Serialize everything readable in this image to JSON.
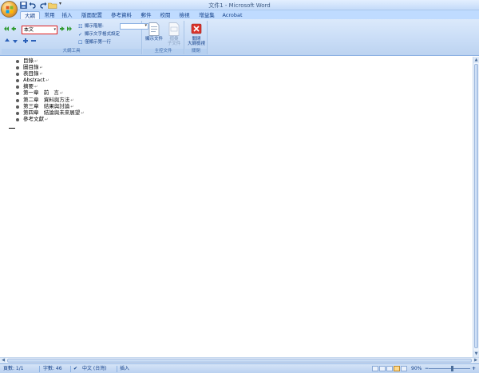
{
  "window_title": "文件1 - Microsoft Word",
  "tabs": [
    {
      "label": "大綱",
      "active": true
    },
    {
      "label": "常用",
      "active": false
    },
    {
      "label": "插入",
      "active": false
    },
    {
      "label": "版面配置",
      "active": false
    },
    {
      "label": "參考資料",
      "active": false
    },
    {
      "label": "郵件",
      "active": false
    },
    {
      "label": "校閱",
      "active": false
    },
    {
      "label": "檢視",
      "active": false
    },
    {
      "label": "增益集",
      "active": false
    },
    {
      "label": "Acrobat",
      "active": false
    }
  ],
  "ribbon": {
    "outline_tools": {
      "level_value": "本文",
      "show_level_label": "顯示階層:",
      "show_text_format_label": "顯示文字格式設定",
      "show_first_line_only_label": "僅顯示第一行",
      "show_text_format_checked": true,
      "show_first_line_only_checked": false,
      "group_label": "大綱工具"
    },
    "master_document": {
      "show_document_label": "顯示文件",
      "collapse_subdocuments_label_1": "摺疊",
      "collapse_subdocuments_label_2": "子文件",
      "group_label": "主控文件"
    },
    "close": {
      "close_outline_label_1": "關閉",
      "close_outline_label_2": "大綱檢視",
      "group_label": "關閉"
    }
  },
  "outline": [
    "目錄",
    "圖目錄",
    "表目錄",
    "Abstract",
    "摘要",
    "第一章   前   言",
    "第二章   資料與方法",
    "第三章   結果與討論",
    "第四章   結論與未來展望",
    "參考文獻"
  ],
  "status": {
    "page": "頁數: 1/1",
    "words": "字數: 46",
    "language": "中文 (台灣)",
    "mode": "插入",
    "zoom": "90%",
    "zoom_out": "−",
    "zoom_in": "+"
  },
  "colors": {
    "ribbon_accent": "#15428b",
    "tab_bar": "#bfdbff",
    "level_box_highlight": "#e02020"
  },
  "icons": {
    "office_button": "office-logo-icon",
    "quick_save": "save-icon",
    "quick_undo": "undo-icon",
    "quick_redo": "redo-icon",
    "quick_open": "open-folder-icon",
    "promote_heading": "promote-to-heading-icon",
    "promote": "promote-icon",
    "demote": "demote-icon",
    "demote_body": "demote-to-body-icon",
    "move_up": "move-up-icon",
    "move_down": "move-down-icon",
    "expand": "expand-icon",
    "collapse": "collapse-icon",
    "show_document": "show-document-icon",
    "collapse_subdocuments": "collapse-subdocuments-icon",
    "close_outline": "close-red-x-icon"
  }
}
